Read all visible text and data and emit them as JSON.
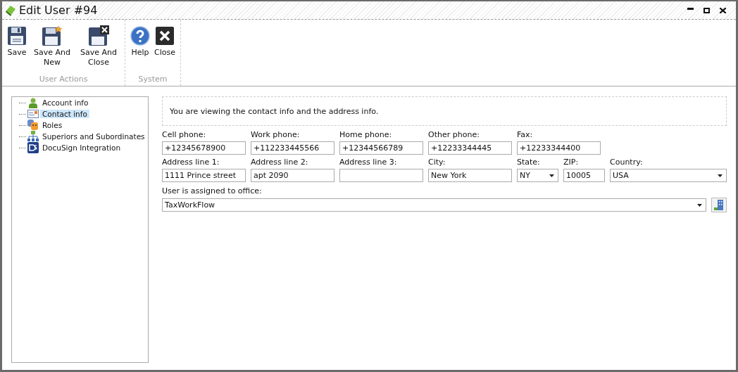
{
  "window": {
    "title": "Edit User #94"
  },
  "ribbon": {
    "groups": [
      {
        "label": "User Actions",
        "buttons": [
          {
            "label": "Save"
          },
          {
            "label": "Save And New"
          },
          {
            "label": "Save And Close"
          }
        ]
      },
      {
        "label": "System",
        "buttons": [
          {
            "label": "Help"
          },
          {
            "label": "Close"
          }
        ]
      }
    ]
  },
  "tree": {
    "items": [
      {
        "label": "Account info",
        "selected": false
      },
      {
        "label": "Contact info",
        "selected": true
      },
      {
        "label": "Roles",
        "selected": false
      },
      {
        "label": "Superiors and Subordinates",
        "selected": false
      },
      {
        "label": "DocuSign Integration",
        "selected": false
      }
    ]
  },
  "info": "You are viewing the contact info and the address info.",
  "rows": [
    [
      {
        "label": "Cell phone:",
        "value": "+12345678900",
        "kind": "text"
      },
      {
        "label": "Work phone:",
        "value": "+112233445566",
        "kind": "text"
      },
      {
        "label": "Home phone:",
        "value": "+12344566789",
        "kind": "text"
      },
      {
        "label": "Other phone:",
        "value": "+12233344445",
        "kind": "text"
      },
      {
        "label": "Fax:",
        "value": "+12233344400",
        "kind": "wide"
      }
    ],
    [
      {
        "label": "Address line 1:",
        "value": "1111 Prince street",
        "kind": "text"
      },
      {
        "label": "Address line 2:",
        "value": "apt 2090",
        "kind": "text"
      },
      {
        "label": "Address line 3:",
        "kind": "text"
      },
      {
        "label": "City:",
        "value": "New York",
        "kind": "text"
      },
      {
        "label": "State:",
        "value": "NY",
        "kind": "select"
      },
      {
        "label": "ZIP:",
        "value": "10005",
        "kind": "text"
      },
      {
        "label": "Country:",
        "value": "USA",
        "kind": "select"
      }
    ]
  ],
  "office": {
    "label": "User is assigned to office:",
    "value": "TaxWorkFlow"
  }
}
